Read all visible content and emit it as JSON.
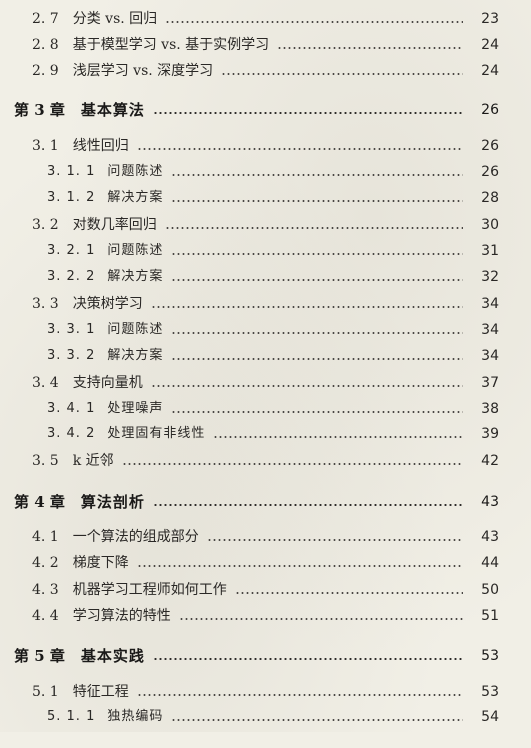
{
  "toc": {
    "rows": [
      {
        "kind": "section",
        "num": "2. 7",
        "title": "分类 vs. 回归",
        "page": "23"
      },
      {
        "kind": "section",
        "num": "2. 8",
        "title": "基于模型学习 vs. 基于实例学习",
        "page": "24"
      },
      {
        "kind": "section",
        "num": "2. 9",
        "title": "浅层学习 vs. 深度学习",
        "page": "24"
      },
      {
        "kind": "chapter",
        "num": "第 3 章",
        "title": "基本算法",
        "page": "26"
      },
      {
        "kind": "section",
        "num": "3. 1",
        "title": "线性回归",
        "page": "26"
      },
      {
        "kind": "sub",
        "num": "3. 1. 1",
        "title": "问题陈述",
        "page": "26"
      },
      {
        "kind": "sub",
        "num": "3. 1. 2",
        "title": "解决方案",
        "page": "28"
      },
      {
        "kind": "section",
        "num": "3. 2",
        "title": "对数几率回归",
        "page": "30"
      },
      {
        "kind": "sub",
        "num": "3. 2. 1",
        "title": "问题陈述",
        "page": "31"
      },
      {
        "kind": "sub",
        "num": "3. 2. 2",
        "title": "解决方案",
        "page": "32"
      },
      {
        "kind": "section",
        "num": "3. 3",
        "title": "决策树学习",
        "page": "34"
      },
      {
        "kind": "sub",
        "num": "3. 3. 1",
        "title": "问题陈述",
        "page": "34"
      },
      {
        "kind": "sub",
        "num": "3. 3. 2",
        "title": "解决方案",
        "page": "34"
      },
      {
        "kind": "section",
        "num": "3. 4",
        "title": "支持向量机",
        "page": "37"
      },
      {
        "kind": "sub",
        "num": "3. 4. 1",
        "title": "处理噪声",
        "page": "38"
      },
      {
        "kind": "sub",
        "num": "3. 4. 2",
        "title": "处理固有非线性",
        "page": "39"
      },
      {
        "kind": "section",
        "num": "3. 5",
        "title": "k 近邻",
        "page": "42"
      },
      {
        "kind": "chapter",
        "num": "第 4 章",
        "title": "算法剖析",
        "page": "43"
      },
      {
        "kind": "section",
        "num": "4. 1",
        "title": "一个算法的组成部分",
        "page": "43"
      },
      {
        "kind": "section",
        "num": "4. 2",
        "title": "梯度下降",
        "page": "44"
      },
      {
        "kind": "section",
        "num": "4. 3",
        "title": "机器学习工程师如何工作",
        "page": "50"
      },
      {
        "kind": "section",
        "num": "4. 4",
        "title": "学习算法的特性",
        "page": "51"
      },
      {
        "kind": "chapter",
        "num": "第 5 章",
        "title": "基本实践",
        "page": "53"
      },
      {
        "kind": "section",
        "num": "5. 1",
        "title": "特征工程",
        "page": "53"
      },
      {
        "kind": "sub",
        "num": "5. 1. 1",
        "title": "独热编码",
        "page": "54"
      }
    ]
  },
  "colors": {
    "paper": "#f1efe6",
    "ink": "#2a2826"
  }
}
